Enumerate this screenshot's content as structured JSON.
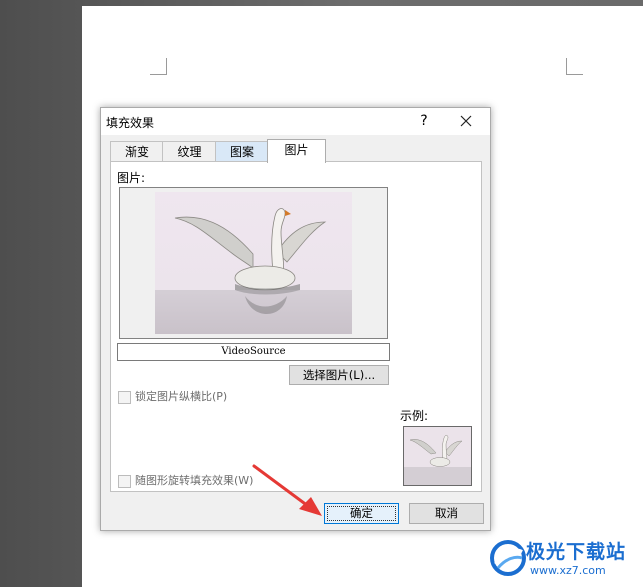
{
  "dialog": {
    "title": "填充效果",
    "help_label": "?",
    "tabs": [
      "渐变",
      "纹理",
      "图案",
      "图片"
    ],
    "active_tab": "图片",
    "picture_label": "图片:",
    "filename": "VideoSource",
    "select_button": "选择图片(L)...",
    "lock_aspect_label": "锁定图片纵横比(P)",
    "sample_label": "示例:",
    "rotate_label": "随图形旋转填充效果(W)",
    "ok_button": "确定",
    "cancel_button": "取消"
  },
  "colors": {
    "accent": "#0078d7",
    "arrow": "#e53935",
    "watermark": "#1b6ed0"
  },
  "watermark": {
    "title": "极光下载站",
    "url": "www.xz7.com"
  }
}
